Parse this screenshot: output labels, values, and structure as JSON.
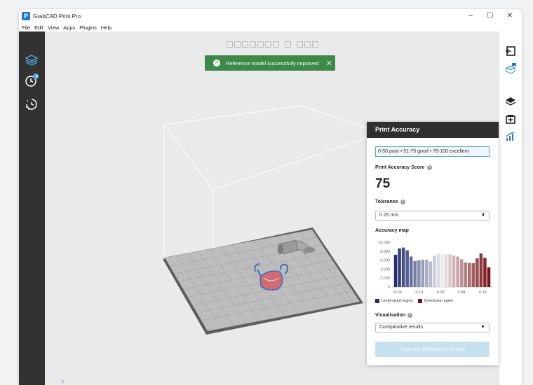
{
  "window": {
    "title": "GrabCAD Print Pro",
    "app_icon_letter": "P",
    "controls": {
      "minimize": "–",
      "maximize": "☐",
      "close": "✕"
    }
  },
  "menu": [
    "File",
    "Edit",
    "View",
    "Apps",
    "Plugins",
    "Help"
  ],
  "left_toolbar": {
    "items": [
      {
        "icon": "cube-layers-icon"
      },
      {
        "icon": "history-clock-icon",
        "badge": "4"
      },
      {
        "icon": "loading-clock-icon"
      }
    ]
  },
  "right_toolbar": {
    "items": [
      {
        "icon": "exit-icon"
      },
      {
        "icon": "printer-cube-icon",
        "badge": "new"
      },
      {
        "icon": "stack-layers-icon"
      },
      {
        "icon": "add-folder-icon"
      },
      {
        "icon": "accuracy-chart-icon"
      }
    ]
  },
  "toast": {
    "message": "Reference model successfully improved",
    "close": "✕"
  },
  "panel": {
    "title": "Print Accuracy",
    "legend_text": "0-50 poor  •  51-75 good  •  76-100 excellent",
    "score_label": "Print Accuracy Score",
    "score_value": "75",
    "tolerance_label": "Tolerance",
    "tolerance_value": "0.25 mm",
    "map_label": "Accuracy map",
    "undersized_label": "Undersized region",
    "oversized_label": "Oversized region",
    "visualisation_label": "Visualisation",
    "visualisation_value": "Comparative results",
    "improve_button": "Improve Reference Model",
    "info_glyph": "i"
  },
  "colors": {
    "toast_green": "#3d8a48",
    "undersized": "#23306f",
    "oversized": "#7a1418",
    "button_disabled": "#c6e1ee",
    "accent_blue": "#1f78c8"
  },
  "chart_data": {
    "type": "bar",
    "title": "Accuracy map",
    "xlabel": "",
    "ylabel": "",
    "ylim": [
      0,
      10000
    ],
    "y_ticks": [
      "0",
      "2,000",
      "4,000",
      "6,000",
      "8,000",
      "10,000"
    ],
    "x_ticks": [
      "-0.25",
      "-0.14",
      "-0.03",
      "0.08",
      "0.19"
    ],
    "x_range": [
      -0.27,
      0.25
    ],
    "bins": [
      -0.26,
      -0.24,
      -0.22,
      -0.2,
      -0.18,
      -0.16,
      -0.14,
      -0.12,
      -0.1,
      -0.08,
      -0.06,
      -0.04,
      -0.02,
      0.0,
      0.02,
      0.04,
      0.06,
      0.08,
      0.1,
      0.12,
      0.14,
      0.16,
      0.18,
      0.2,
      0.22
    ],
    "values": [
      7200,
      8600,
      8800,
      8200,
      6800,
      5800,
      6000,
      6100,
      6100,
      5700,
      7000,
      7500,
      7400,
      7300,
      7300,
      7000,
      6800,
      6200,
      5500,
      5400,
      5300,
      6400,
      7500,
      6500,
      4400
    ]
  }
}
